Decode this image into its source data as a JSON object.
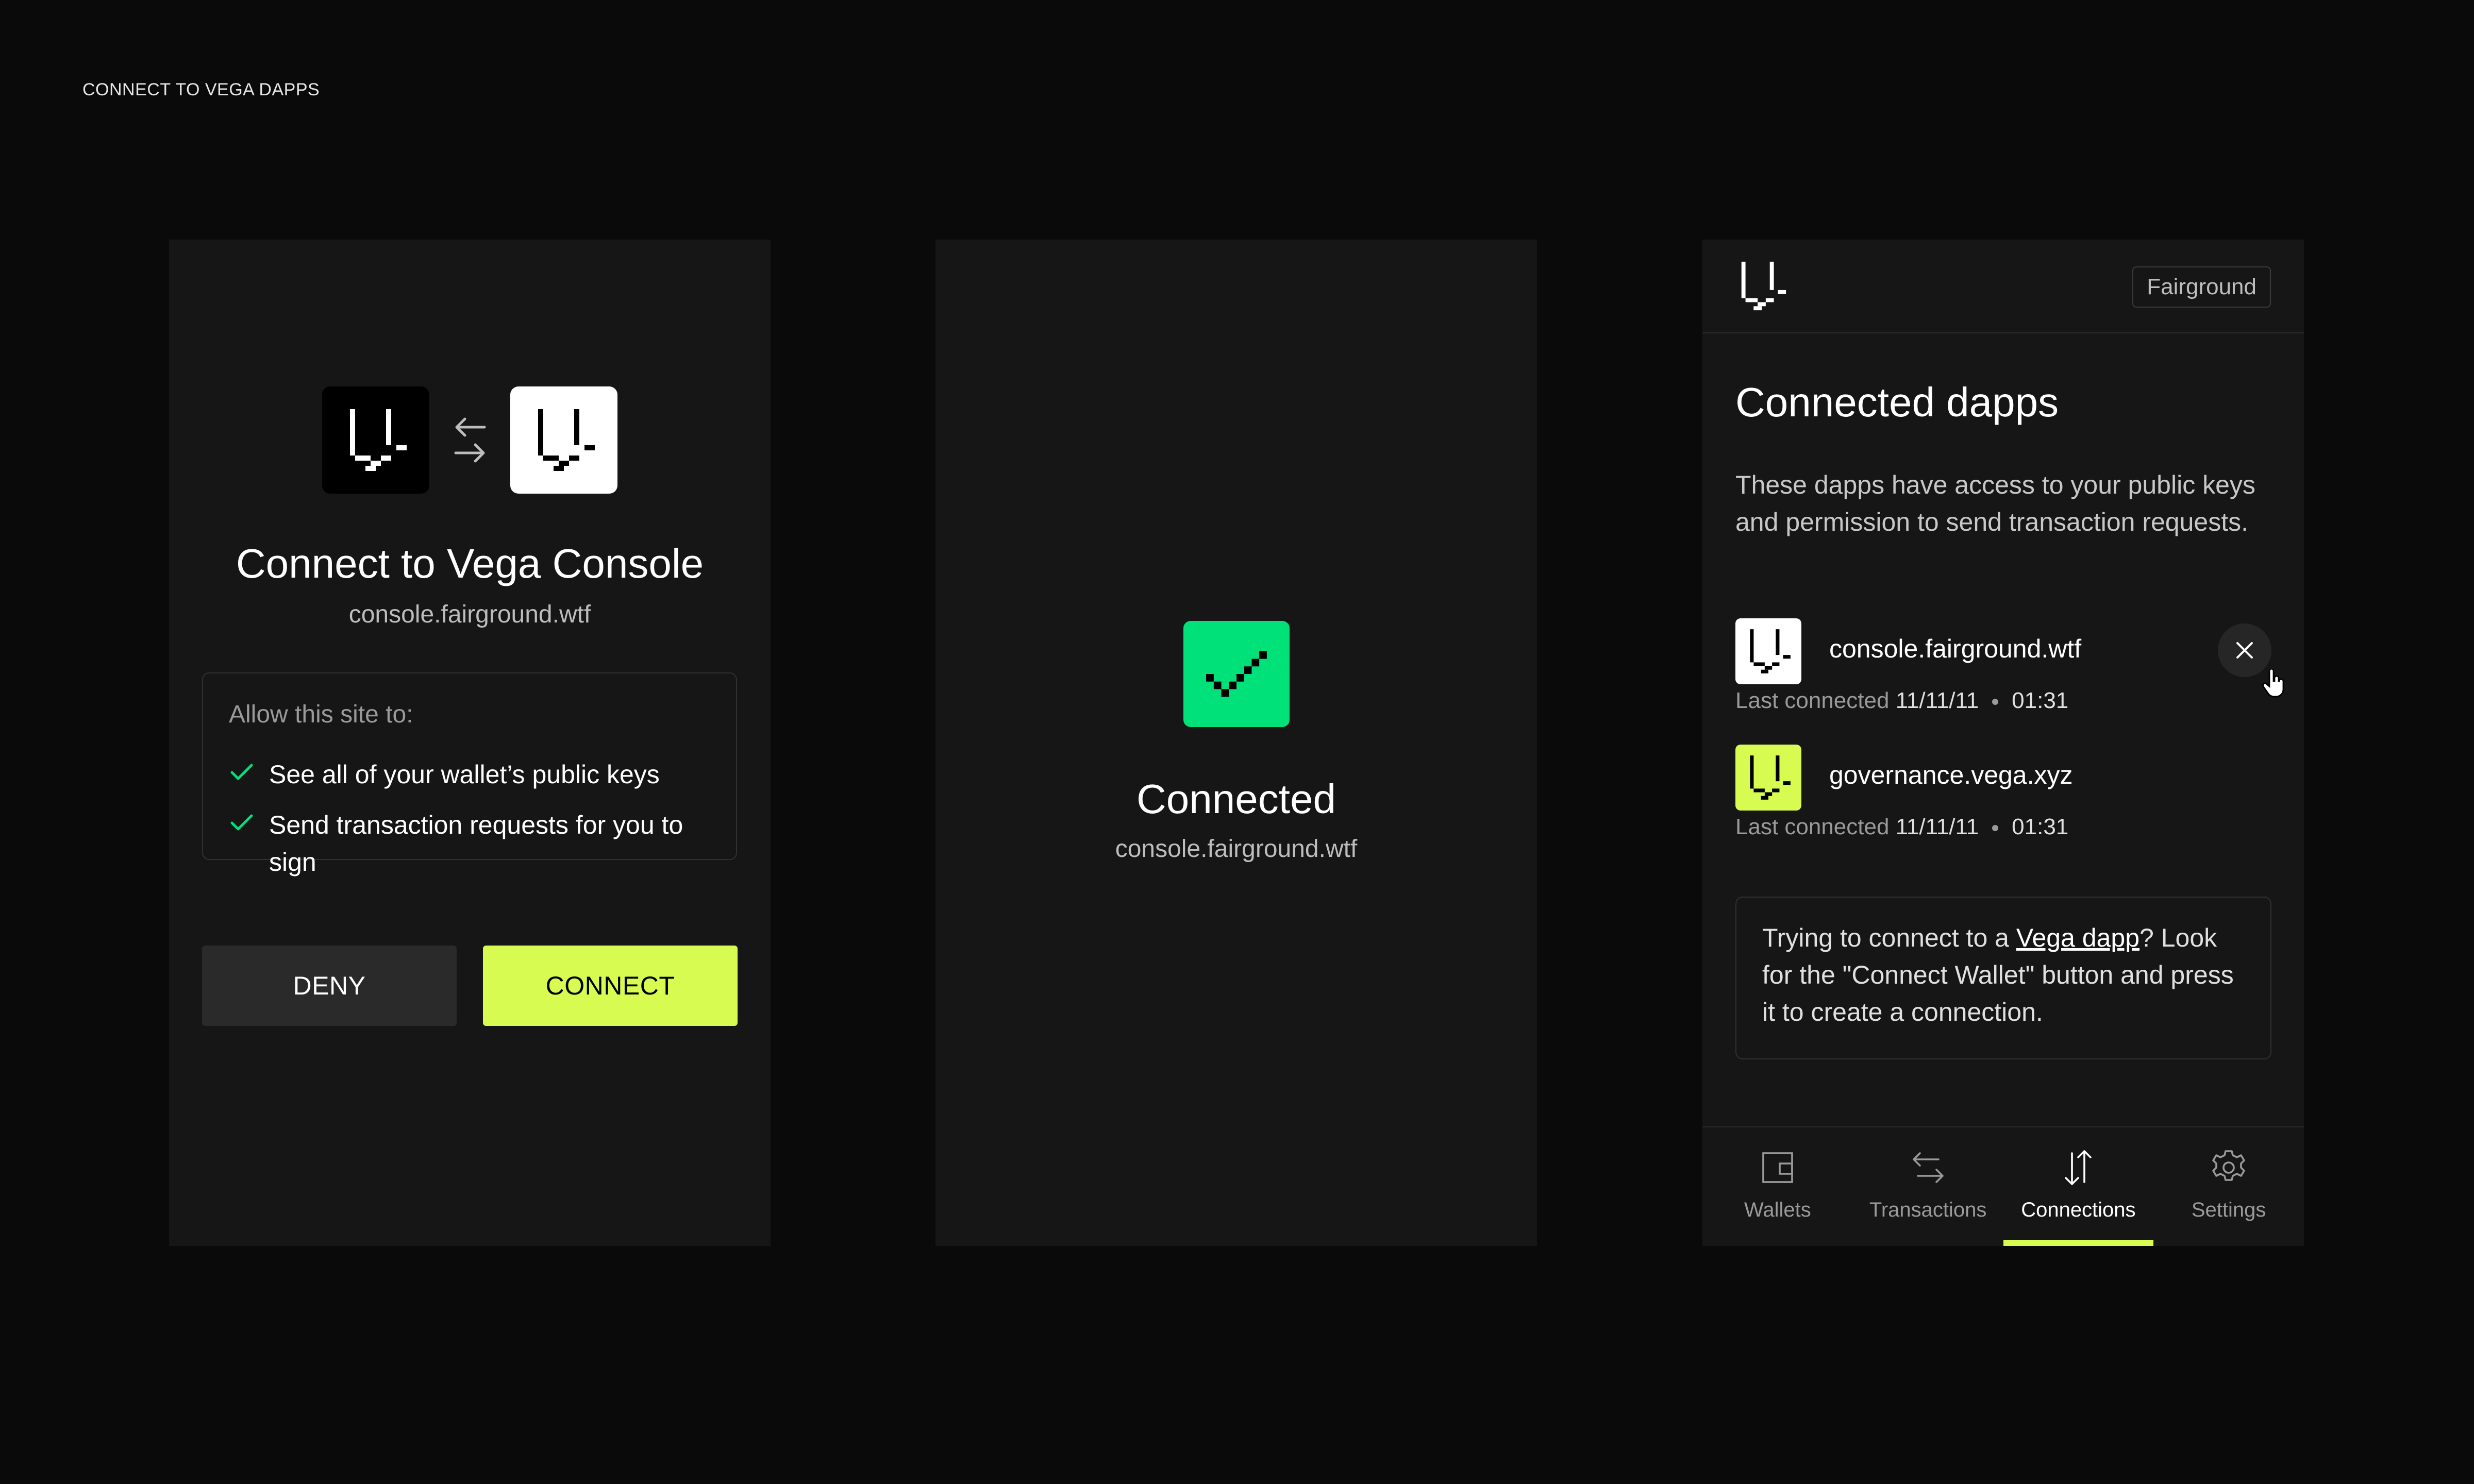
{
  "page_label": "CONNECT TO VEGA DAPPS",
  "colors": {
    "accent": "#d7fb50",
    "success": "#00e17a",
    "panel_bg": "#161616",
    "page_bg": "#0a0a0a"
  },
  "connect_screen": {
    "title": "Connect to Vega Console",
    "url": "console.fairground.wtf",
    "permissions_heading": "Allow this site to:",
    "permissions": [
      "See all of your wallet’s public keys",
      "Send transaction requests for you to sign"
    ],
    "deny_label": "DENY",
    "connect_label": "CONNECT"
  },
  "connected_screen": {
    "title": "Connected",
    "url": "console.fairground.wtf"
  },
  "dapps_screen": {
    "network": "Fairground",
    "title": "Connected dapps",
    "description": "These dapps have access to your public keys and permission to send transaction requests.",
    "last_connected_label": "Last connected",
    "dapps": [
      {
        "name": "console.fairground.wtf",
        "date": "11/11/11",
        "time": "01:31"
      },
      {
        "name": "governance.vega.xyz",
        "date": "11/11/11",
        "time": "01:31"
      }
    ],
    "help": {
      "prefix": "Trying to connect to a ",
      "link": "Vega dapp",
      "suffix": "? Look for the \"Connect Wallet\" button and press it to create a connection."
    },
    "tabs": [
      {
        "label": "Wallets",
        "icon": "wallet-icon"
      },
      {
        "label": "Transactions",
        "icon": "transactions-icon"
      },
      {
        "label": "Connections",
        "icon": "connections-icon",
        "active": true
      },
      {
        "label": "Settings",
        "icon": "settings-icon"
      }
    ]
  }
}
